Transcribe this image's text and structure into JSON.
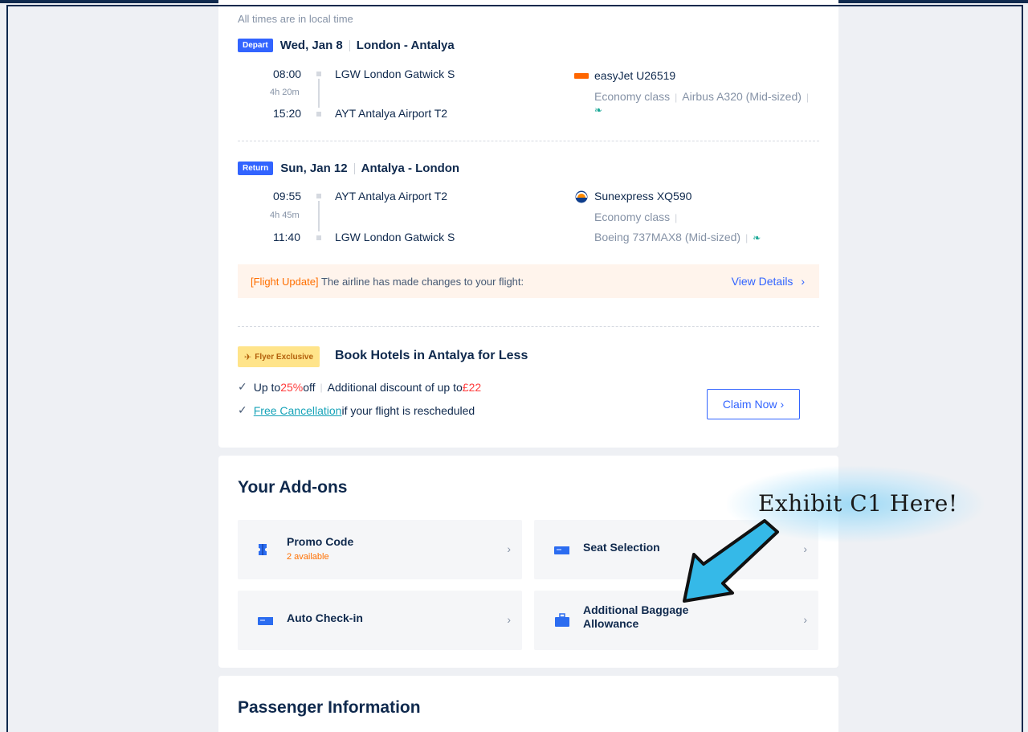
{
  "trip": {
    "local_time_note": "All times are in local time",
    "depart": {
      "tag": "Depart",
      "date": "Wed, Jan 8",
      "route": "London - Antalya",
      "dep_time": "08:00",
      "duration": "4h 20m",
      "arr_time": "15:20",
      "dep_airport": "LGW  London Gatwick S",
      "arr_airport": "AYT  Antalya Airport T2",
      "airline": "easyJet U26519",
      "cabin": "Economy class",
      "aircraft": "Airbus A320 (Mid-sized)"
    },
    "return": {
      "tag": "Return",
      "date": "Sun, Jan 12",
      "route": "Antalya - London",
      "dep_time": "09:55",
      "duration": "4h 45m",
      "arr_time": "11:40",
      "dep_airport": "AYT  Antalya Airport T2",
      "arr_airport": "LGW  London Gatwick S",
      "airline": "Sunexpress XQ590",
      "cabin": "Economy class",
      "aircraft": "Boeing 737MAX8 (Mid-sized)"
    },
    "update": {
      "tag": "[Flight Update]",
      "message": "The airline has made changes to your flight:",
      "link": "View Details"
    },
    "flyer": {
      "badge": "Flyer Exclusive",
      "title": "Book Hotels in Antalya for Less",
      "perk1_pre": "Up to ",
      "perk1_pct": "25%",
      "perk1_post": " off",
      "perk1_extra": "Additional discount of up to ",
      "perk1_amount": "£22",
      "perk2_link": "Free Cancellation",
      "perk2_post": " if your flight is rescheduled",
      "claim": "Claim Now"
    }
  },
  "addons": {
    "title": "Your Add-ons",
    "items": [
      {
        "label": "Promo Code",
        "sub": "2 available",
        "icon": "ticket-icon"
      },
      {
        "label": "Seat Selection",
        "icon": "seat-icon"
      },
      {
        "label": "Auto Check-in",
        "icon": "checkin-icon"
      },
      {
        "label": "Additional Baggage Allowance",
        "icon": "luggage-icon"
      }
    ]
  },
  "passenger": {
    "title": "Passenger Information"
  },
  "annotation": {
    "text": "Exhibit C1 Here!"
  },
  "colors": {
    "accent": "#3264ff",
    "warning": "#ff6f00",
    "navy": "#0f294d",
    "arrow": "#35b9e8"
  }
}
